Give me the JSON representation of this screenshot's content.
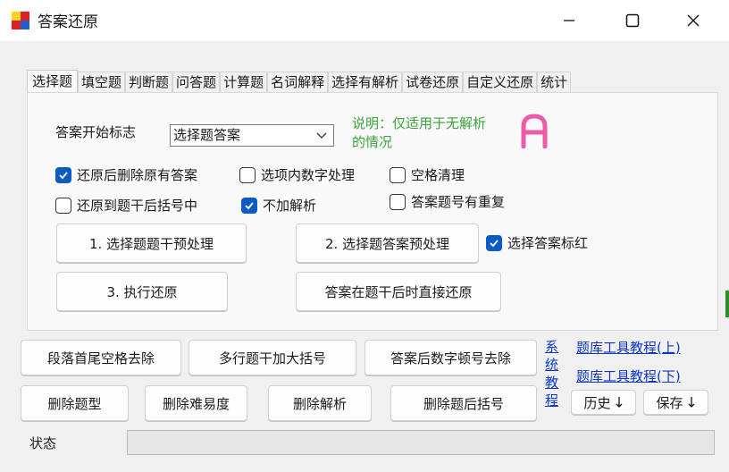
{
  "window": {
    "title": "答案还原"
  },
  "tabs": [
    "选择题",
    "填空题",
    "判断题",
    "问答题",
    "计算题",
    "名词解释",
    "选择有解析",
    "试卷还原",
    "自定义还原",
    "统计"
  ],
  "tab_active_index": 0,
  "panel": {
    "start_marker_label": "答案开始标志",
    "start_marker_value": "选择题答案",
    "note": "说明：仅适用于无解析的情况",
    "big_letter": "A",
    "big_letter_color": "#ee5aa8",
    "checkboxes": {
      "remove_existing": {
        "label": "还原后删除原有答案",
        "checked": true
      },
      "digit_in_options": {
        "label": "选项内数字处理",
        "checked": false
      },
      "space_clean": {
        "label": "空格清理",
        "checked": false
      },
      "restore_to_bracket": {
        "label": "还原到题干后括号中",
        "checked": false
      },
      "no_analysis": {
        "label": "不加解析",
        "checked": true
      },
      "duplicate_numbers": {
        "label": "答案题号有重复",
        "checked": false
      },
      "mark_red": {
        "label": "选择答案标红",
        "checked": true
      }
    },
    "buttons": {
      "preprocess_stem": "1. 选择题题干预处理",
      "preprocess_answer": "2. 选择题答案预处理",
      "execute": "3. 执行还原",
      "direct_restore": "答案在题干后时直接还原"
    }
  },
  "bottom_buttons": {
    "trim_spaces": "段落首尾空格去除",
    "multi_line_brackets": "多行题干加大括号",
    "remove_digit_comma": "答案后数字顿号去除",
    "delete_type": "删除题型",
    "delete_difficulty": "删除难易度",
    "delete_analysis": "删除解析",
    "delete_bracket": "删除题后括号",
    "history": "历史",
    "save": "保存"
  },
  "links": {
    "system_tutorial": "系统教程",
    "tutorial_up": "题库工具教程(上)",
    "tutorial_down": "题库工具教程(下)"
  },
  "status": {
    "label": "状态"
  },
  "colors": {
    "accent": "#0a5cc2",
    "note": "#3aa33a",
    "link": "#0a37c8"
  }
}
